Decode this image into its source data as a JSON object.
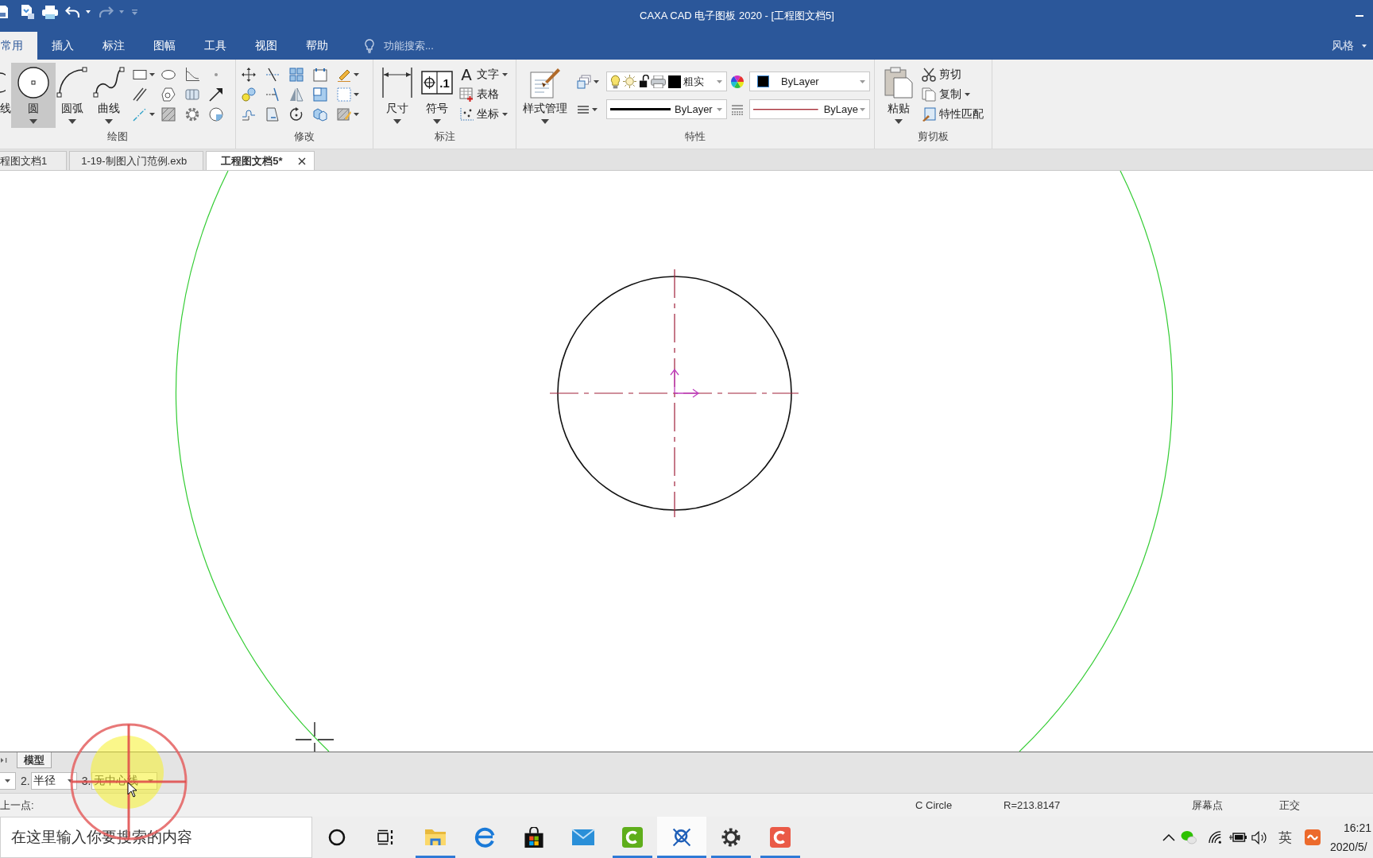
{
  "window": {
    "title": "CAXA CAD 电子图板 2020 - [工程图文档5]"
  },
  "ribbon_tabs": [
    {
      "label": "常用",
      "selected": true
    },
    {
      "label": "插入",
      "selected": false
    },
    {
      "label": "标注",
      "selected": false
    },
    {
      "label": "图幅",
      "selected": false
    },
    {
      "label": "工具",
      "selected": false
    },
    {
      "label": "视图",
      "selected": false
    },
    {
      "label": "帮助",
      "selected": false
    }
  ],
  "feature_search": {
    "placeholder": "功能搜索..."
  },
  "style_menu": {
    "label": "风格"
  },
  "ribbon": {
    "draw": {
      "label": "绘图",
      "tools": [
        {
          "label": "线",
          "selected": false,
          "dropdown": false
        },
        {
          "label": "圆",
          "selected": true,
          "dropdown": true
        },
        {
          "label": "圆弧",
          "selected": false,
          "dropdown": true
        },
        {
          "label": "曲线",
          "selected": false,
          "dropdown": true
        }
      ]
    },
    "modify": {
      "label": "修改"
    },
    "annotate": {
      "label": "标注",
      "tools": [
        {
          "label": "尺寸"
        },
        {
          "label": "符号",
          "icon_text": ".1"
        }
      ],
      "items": [
        {
          "label": "文字",
          "icon_text": "A",
          "dropdown": true
        },
        {
          "label": "表格",
          "dropdown": false
        },
        {
          "label": "坐标",
          "dropdown": true
        }
      ]
    },
    "properties": {
      "label": "特性",
      "style_button": "样式管理",
      "layer": "粗实",
      "color_setting": "ByLayer",
      "line_width": "ByLayer",
      "line_type": "ByLaye"
    },
    "clipboard": {
      "label": "剪切板",
      "paste": "粘贴",
      "items": [
        {
          "label": "剪切",
          "dropdown": false
        },
        {
          "label": "复制",
          "dropdown": true
        },
        {
          "label": "特性匹配",
          "dropdown": false
        }
      ]
    }
  },
  "doc_tabs": [
    {
      "label": "程图文档1",
      "selected": false
    },
    {
      "label": "1-19-制图入门范例.exb",
      "selected": false
    },
    {
      "label": "工程图文档5*",
      "selected": true
    }
  ],
  "layout_tabs": [
    {
      "label": "模型",
      "selected": true
    }
  ],
  "command_options": [
    {
      "index": "2.",
      "value": "半径"
    },
    {
      "index": "3.",
      "value": "无中心线"
    }
  ],
  "status_bar": {
    "prompt": "上一点:",
    "command": "C Circle",
    "readout": "R=213.8147",
    "modes": [
      "屏幕点",
      "正交"
    ]
  },
  "taskbar": {
    "search": {
      "placeholder": "在这里输入你要搜索的内容"
    },
    "apps": [
      {
        "kind": "ring",
        "running": false,
        "active": false
      },
      {
        "kind": "task-view",
        "running": false,
        "active": false
      },
      {
        "kind": "folder",
        "running": true,
        "active": false
      },
      {
        "kind": "browser",
        "running": false,
        "active": false
      },
      {
        "kind": "store",
        "running": false,
        "active": false
      },
      {
        "kind": "mail",
        "running": false,
        "active": false
      },
      {
        "kind": "recorder",
        "running": true,
        "active": false
      },
      {
        "kind": "cad",
        "running": true,
        "active": true
      },
      {
        "kind": "gear",
        "running": true,
        "active": false
      },
      {
        "kind": "editor",
        "running": true,
        "active": false
      }
    ],
    "tray": {
      "input_mode": "英",
      "time": "16:21",
      "date": "2020/5/"
    }
  }
}
